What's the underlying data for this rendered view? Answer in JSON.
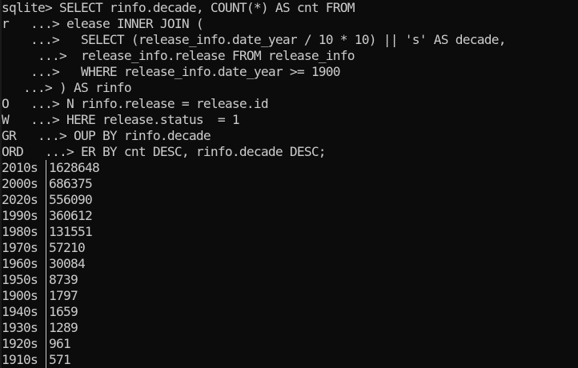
{
  "terminal": {
    "lines": [
      "sqlite> SELECT rinfo.decade, COUNT(*) AS cnt FROM",
      "r   ...> elease INNER JOIN (",
      "    ...>   SELECT (release_info.date_year / 10 * 10) || 's' AS decade,",
      "     ...>  release_info.release FROM release_info",
      "    ...>   WHERE release_info.date_year >= 1900",
      "   ...> ) AS rinfo",
      "O   ...> N rinfo.release = release.id",
      "W   ...> HERE release.status  = 1",
      "GR   ...> OUP BY rinfo.decade",
      "ORD   ...> ER BY cnt DESC, rinfo.decade DESC;"
    ],
    "results": [
      {
        "decade": "2010s",
        "count": "1628648"
      },
      {
        "decade": "2000s",
        "count": "686375"
      },
      {
        "decade": "2020s",
        "count": "556090"
      },
      {
        "decade": "1990s",
        "count": "360612"
      },
      {
        "decade": "1980s",
        "count": "131551"
      },
      {
        "decade": "1970s",
        "count": "57210"
      },
      {
        "decade": "1960s",
        "count": "30084"
      },
      {
        "decade": "1950s",
        "count": "8739"
      },
      {
        "decade": "1900s",
        "count": "1797"
      },
      {
        "decade": "1940s",
        "count": "1659"
      },
      {
        "decade": "1930s",
        "count": "1289"
      },
      {
        "decade": "1920s",
        "count": "961"
      },
      {
        "decade": "1910s",
        "count": "571"
      }
    ],
    "colors": {
      "background": "#0c0c0c",
      "text": "#cccccc"
    }
  }
}
